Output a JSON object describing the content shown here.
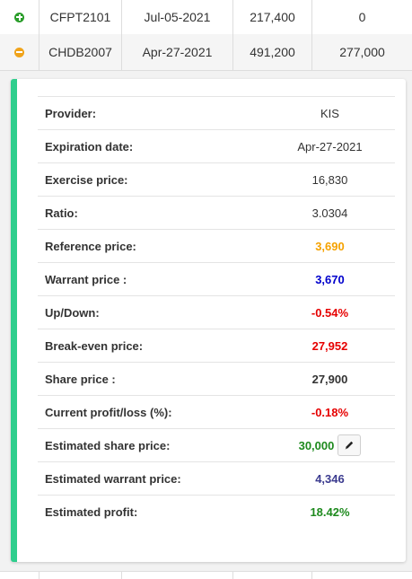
{
  "rows": [
    {
      "code": "CFPT2101",
      "date": "Jul-05-2021",
      "value1": "217,400",
      "value2": "0",
      "icon": "plus-circle-icon",
      "icon_color": "#2a9d2a"
    },
    {
      "code": "CHDB2007",
      "date": "Apr-27-2021",
      "value1": "491,200",
      "value2": "277,000",
      "icon": "minus-circle-icon",
      "icon_color": "#f0a31a"
    }
  ],
  "detail": {
    "accent_color": "#2fce8d",
    "items": [
      {
        "label": "Provider:",
        "value": "KIS",
        "style": "normal"
      },
      {
        "label": "Expiration date:",
        "value": "Apr-27-2021",
        "style": "normal"
      },
      {
        "label": "Exercise price:",
        "value": "16,830",
        "style": "normal"
      },
      {
        "label": "Ratio:",
        "value": "3.0304",
        "style": "normal"
      },
      {
        "label": "Reference price:",
        "value": "3,690",
        "style": "orange"
      },
      {
        "label": "Warrant price :",
        "value": "3,670",
        "style": "blue"
      },
      {
        "label": "Up/Down:",
        "value": "-0.54%",
        "style": "red"
      },
      {
        "label": "Break-even price:",
        "value": "27,952",
        "style": "red"
      },
      {
        "label": "Share price :",
        "value": "27,900",
        "style": "dark"
      },
      {
        "label": "Current profit/loss (%):",
        "value": "-0.18%",
        "style": "red"
      },
      {
        "label": "Estimated share price:",
        "value": "30,000",
        "style": "green",
        "edit_icon": "pencil-icon"
      },
      {
        "label": "Estimated warrant price:",
        "value": "4,346",
        "style": "purple"
      },
      {
        "label": "Estimated profit:",
        "value": "18.42%",
        "style": "green"
      }
    ]
  }
}
